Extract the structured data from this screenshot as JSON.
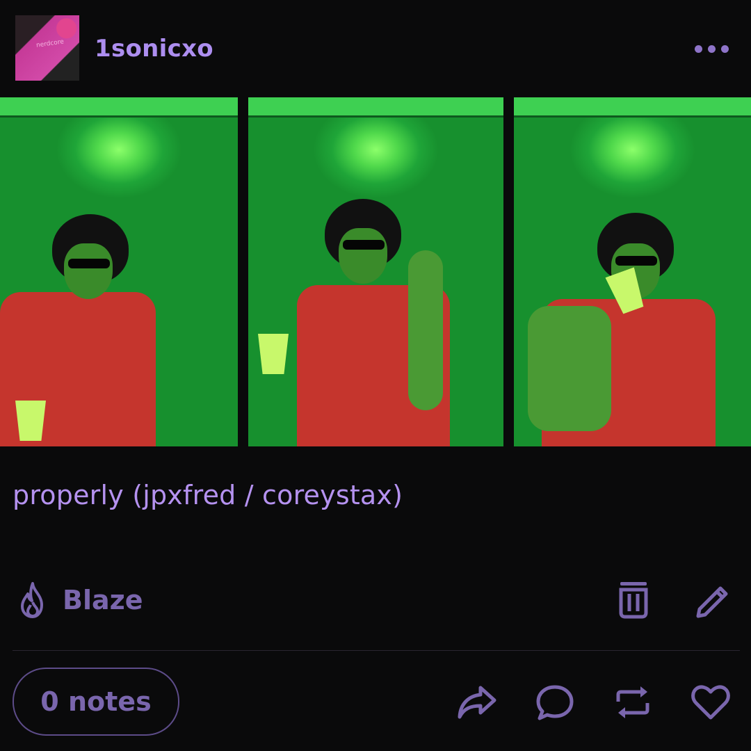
{
  "post": {
    "username": "1sonicxo",
    "avatar_shirt_text": "nerdcore",
    "caption": "properly (jpxfred / coreystax)"
  },
  "actions": {
    "blaze_label": "Blaze",
    "notes_label": "0 notes"
  },
  "colors": {
    "background": "#0a0a0b",
    "accent": "#ad8ef0",
    "muted_accent": "#7a66ad"
  },
  "icons": [
    "more-icon",
    "flame-icon",
    "trash-icon",
    "pencil-icon",
    "share-icon",
    "comment-icon",
    "reblog-icon",
    "heart-icon"
  ]
}
